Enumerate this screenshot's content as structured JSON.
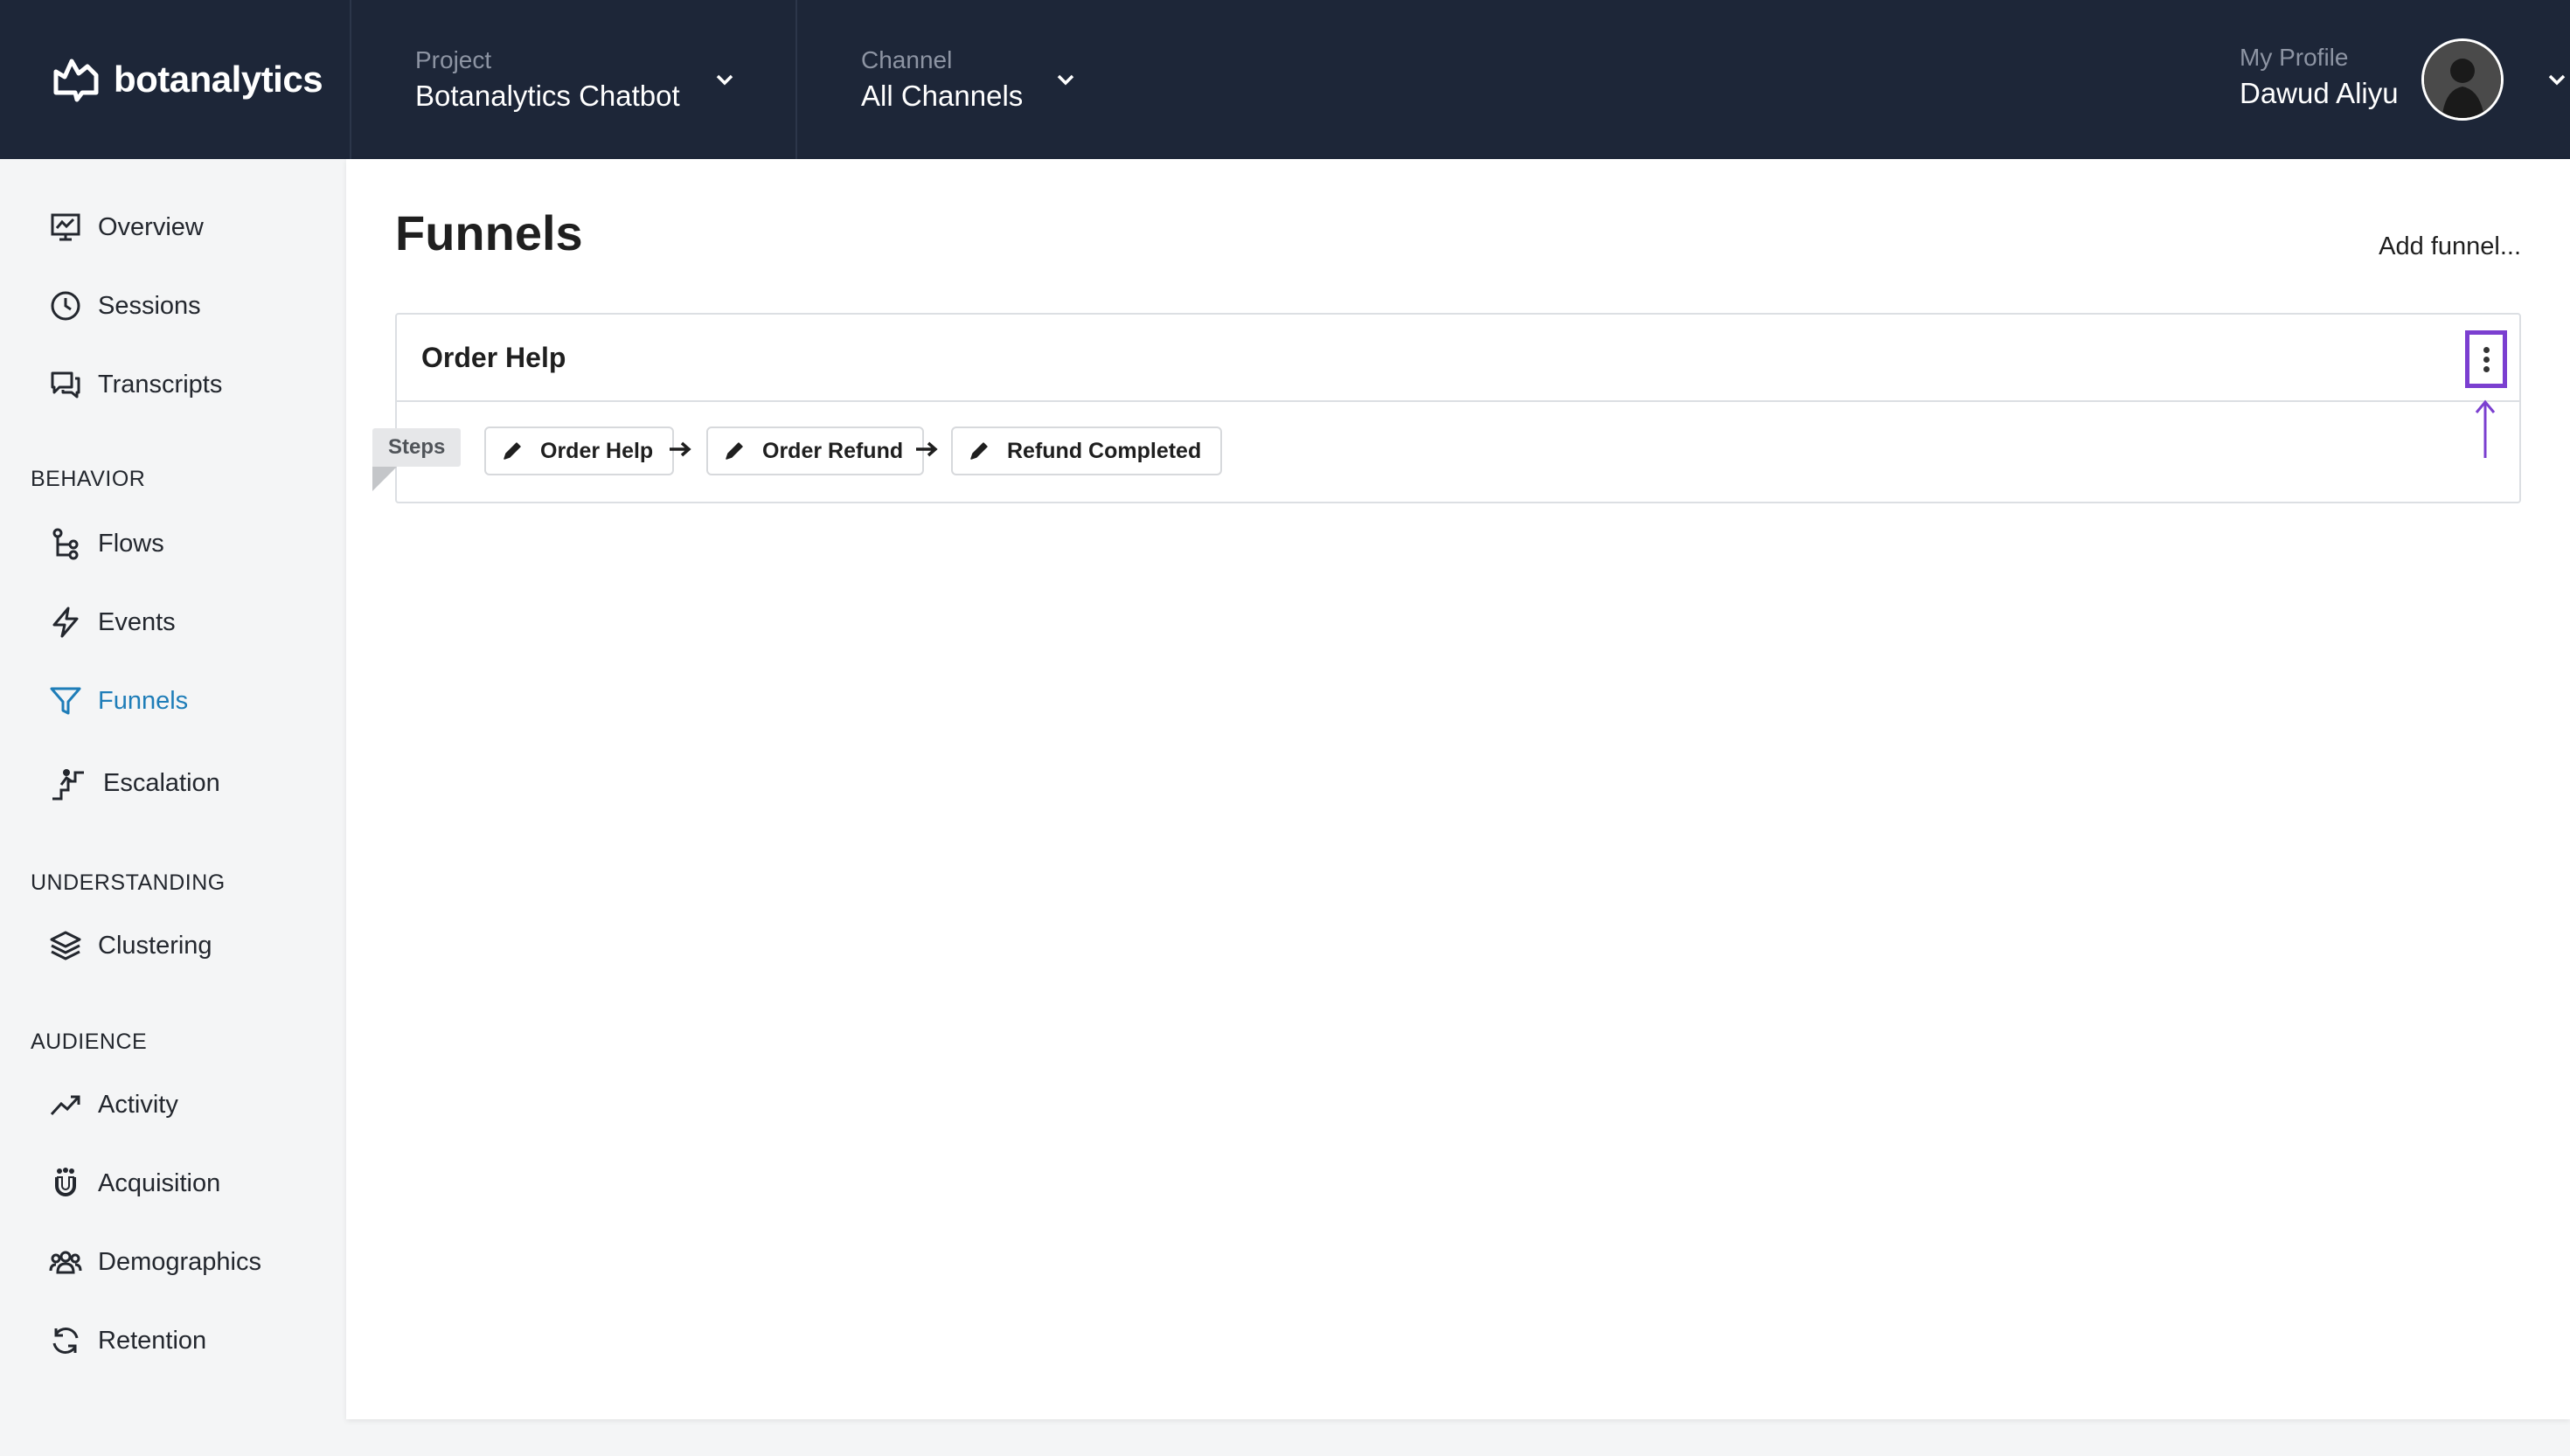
{
  "brand": {
    "name": "botanalytics"
  },
  "header": {
    "project": {
      "label": "Project",
      "value": "Botanalytics Chatbot"
    },
    "channel": {
      "label": "Channel",
      "value": "All Channels"
    },
    "profile": {
      "label": "My Profile",
      "value": "Dawud Aliyu"
    }
  },
  "sidebar": {
    "top_items": [
      {
        "label": "Overview",
        "icon": "overview-icon"
      },
      {
        "label": "Sessions",
        "icon": "clock-icon"
      },
      {
        "label": "Transcripts",
        "icon": "chat-icon"
      }
    ],
    "behavior": {
      "heading": "BEHAVIOR",
      "items": [
        {
          "label": "Flows",
          "icon": "flow-icon"
        },
        {
          "label": "Events",
          "icon": "bolt-icon"
        },
        {
          "label": "Funnels",
          "icon": "funnel-icon",
          "active": true
        },
        {
          "label": "Escalation",
          "icon": "escalation-icon"
        }
      ]
    },
    "understanding": {
      "heading": "UNDERSTANDING",
      "items": [
        {
          "label": "Clustering",
          "icon": "layers-icon"
        }
      ]
    },
    "audience": {
      "heading": "AUDIENCE",
      "items": [
        {
          "label": "Activity",
          "icon": "trend-icon"
        },
        {
          "label": "Acquisition",
          "icon": "magnet-icon"
        },
        {
          "label": "Demographics",
          "icon": "people-icon"
        },
        {
          "label": "Retention",
          "icon": "refresh-icon"
        }
      ]
    }
  },
  "main": {
    "title": "Funnels",
    "add_funnel": "Add funnel...",
    "funnel": {
      "name": "Order Help",
      "steps_label": "Steps",
      "steps": [
        "Order Help",
        "Order Refund",
        "Refund Completed"
      ]
    }
  },
  "colors": {
    "topbar": "#1d2638",
    "accent_active": "#1e7db8",
    "highlight": "#7b3fd0"
  }
}
